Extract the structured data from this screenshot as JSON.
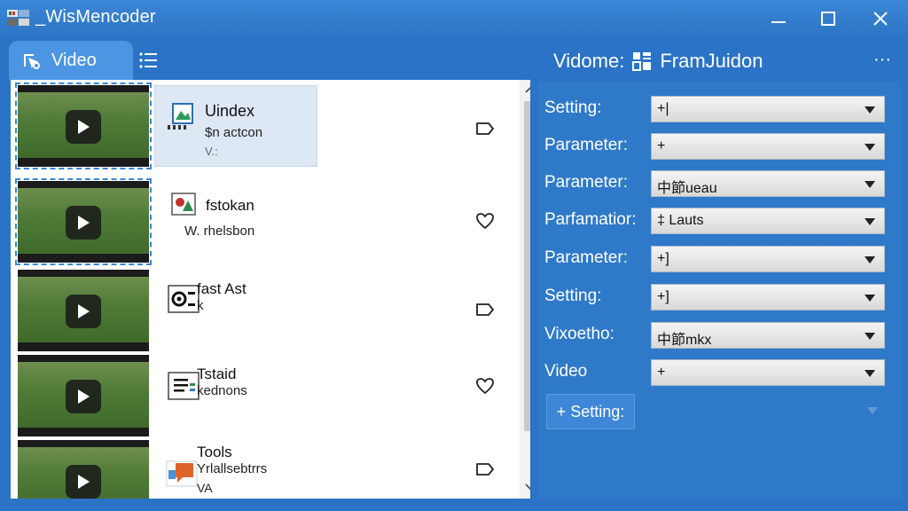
{
  "app": {
    "title": "_WisMencoder"
  },
  "tabs": {
    "video_label": "Video",
    "list_icon": "list-icon"
  },
  "files": [
    {
      "title": "Uindex",
      "subtitle": "$n actcon",
      "version": "V.:",
      "icon": "image-file-icon",
      "selected": true,
      "action_icon": "tag-icon"
    },
    {
      "title": "fstokan",
      "subtitle": "W. rhelsbon",
      "version": "",
      "icon": "photo-icon",
      "selected": false,
      "action_icon": "heart-icon"
    },
    {
      "title": "fast Ast",
      "subtitle": "k",
      "version": "",
      "icon": "gear-settings-icon",
      "selected": false,
      "action_icon": "tag-icon"
    },
    {
      "title": "Tstaid",
      "subtitle": "kednons",
      "version": "",
      "icon": "document-list-icon",
      "selected": false,
      "action_icon": "heart-icon"
    },
    {
      "title": "Tools",
      "subtitle": "Yrlallsebtrrs",
      "version": "VA",
      "icon": "orange-chat-icon",
      "selected": false,
      "action_icon": "tag-icon"
    }
  ],
  "right": {
    "header_left": "Vidome:",
    "header_icon": "grid-icon",
    "header_right": "FramJuidon",
    "more_label": "···",
    "params": [
      {
        "label": "Setting:",
        "value": "+|"
      },
      {
        "label": "Parameter:",
        "value": "+"
      },
      {
        "label": "Parameter:",
        "value": "中節ueau"
      },
      {
        "label": "Parfamatior:",
        "value": "‡ Lauts"
      },
      {
        "label": "Parameter:",
        "value": "+]"
      },
      {
        "label": "Setting:",
        "value": "+]"
      },
      {
        "label": "Vixoetho:",
        "value": "中節mkx"
      },
      {
        "label": "Video",
        "value": "+"
      }
    ],
    "add_setting_label": "+ Setting:"
  },
  "colors": {
    "window_blue": "#2a73c6",
    "tab_blue": "#4b95e2",
    "selection": "#dde8f4"
  }
}
